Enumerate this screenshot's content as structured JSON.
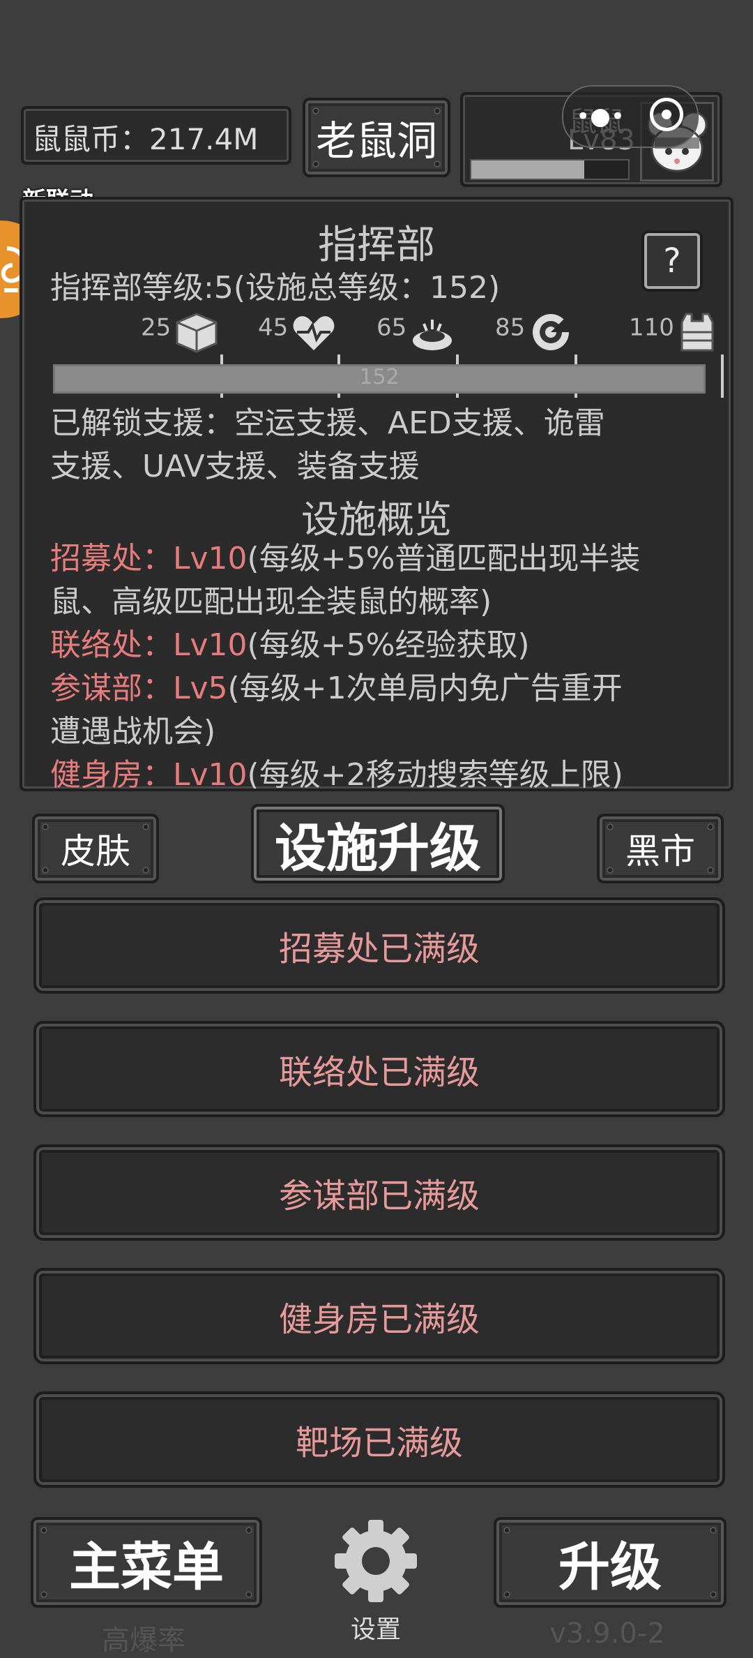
{
  "header": {
    "currency_label": "鼠鼠币：217.4M",
    "hole_button": "老鼠洞",
    "player_name": "鼠鼠",
    "player_level": "Lv83",
    "exp_fraction": 0.72
  },
  "promo": {
    "badge": "新联动",
    "caption": "打 撤"
  },
  "command": {
    "title": "指挥部",
    "help": "?",
    "level_line": "指挥部等级:5(设施总等级：152)",
    "milestones": [
      {
        "value": "25",
        "icon": "box-icon"
      },
      {
        "value": "45",
        "icon": "heartbeat-icon"
      },
      {
        "value": "65",
        "icon": "mine-icon"
      },
      {
        "value": "85",
        "icon": "radar-icon"
      },
      {
        "value": "110",
        "icon": "vest-icon"
      }
    ],
    "progress_value": "152",
    "progress_fraction": 1.0,
    "unlocked_1": "已解锁支援：空运支援、AED支援、诡雷",
    "unlocked_2": "支援、UAV支援、装备支援",
    "overview_title": "设施概览",
    "facilities": [
      {
        "name": "招募处：Lv10",
        "desc1": "(每级+5%普通匹配出现半装",
        "desc2": "鼠、高级匹配出现全装鼠的概率)"
      },
      {
        "name": "联络处：Lv10",
        "desc1": "(每级+5%经验获取)",
        "desc2": ""
      },
      {
        "name": "参谋部：Lv5",
        "desc1": "(每级+1次单局内免广告重开",
        "desc2": "遭遇战机会)"
      },
      {
        "name": "健身房：Lv10",
        "desc1": "(每级+2移动搜索等级上限)",
        "desc2": ""
      }
    ]
  },
  "tabs": {
    "skin": "皮肤",
    "upgrade": "设施升级",
    "black_market": "黑市"
  },
  "upgrades": [
    "招募处已满级",
    "联络处已满级",
    "参谋部已满级",
    "健身房已满级",
    "靶场已满级"
  ],
  "footer": {
    "main_menu": "主菜单",
    "main_menu_sub": "高爆率",
    "settings": "设置",
    "level_up": "升级",
    "version": "v3.9.0-2"
  },
  "colors": {
    "accent_red": "#e67c7c",
    "bg": "#3d3d3d",
    "panel": "#2b2b2b"
  }
}
